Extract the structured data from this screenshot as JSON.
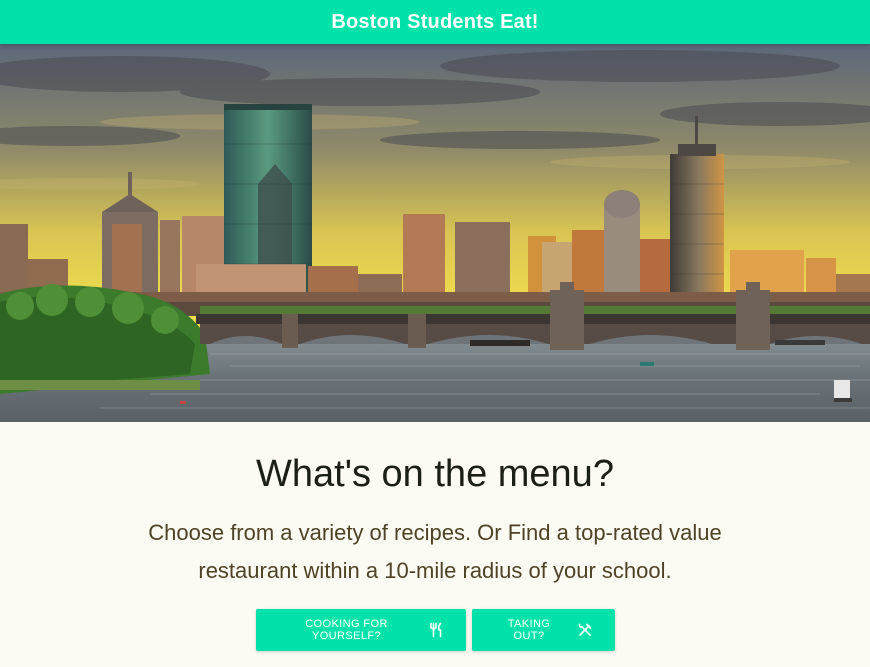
{
  "header": {
    "title": "Boston Students Eat!",
    "color": "#00e2a9"
  },
  "hero": {
    "image": "boston-skyline-over-charles-river-at-sunset"
  },
  "main": {
    "headline": "What's on the menu?",
    "lede": "Choose from a variety of recipes. Or Find a top-rated value restaurant within a 10-mile radius of your school.",
    "buttons": [
      {
        "label": "COOKING FOR YOURSELF?",
        "icon": "fork-knife-icon"
      },
      {
        "label": "TAKING OUT?",
        "icon": "crossed-utensils-icon"
      }
    ]
  },
  "colors": {
    "accent": "#00e2a9",
    "background": "#fbfbf4",
    "headline_text": "#1c1f14",
    "body_text": "#4e4326"
  }
}
